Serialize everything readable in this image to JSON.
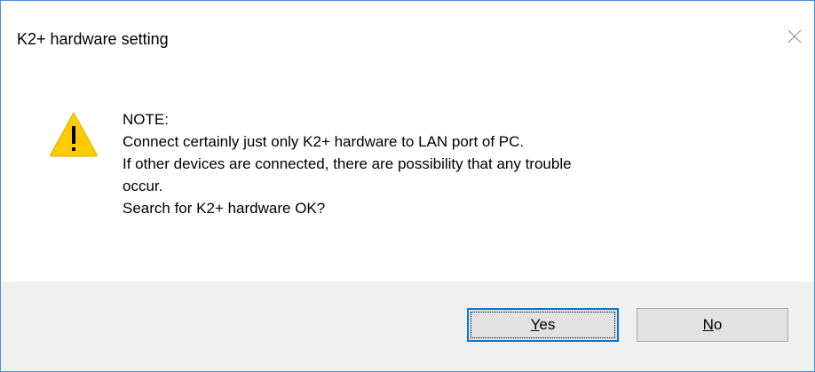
{
  "window": {
    "title": "K2+ hardware setting",
    "close_icon": "close-icon"
  },
  "message": {
    "icon": "warning-icon",
    "lines": [
      "NOTE:",
      "Connect certainly just only K2+ hardware to LAN port of PC.",
      "If other devices are connected, there are possibility that any trouble",
      "occur.",
      "Search for K2+ hardware OK?"
    ]
  },
  "buttons": {
    "yes": {
      "mnemonic": "Y",
      "rest": "es",
      "focused": true
    },
    "no": {
      "mnemonic": "N",
      "rest": "o"
    }
  },
  "colors": {
    "window_border": "#4a90d9",
    "footer_background": "#f0f0f0",
    "button_background": "#e1e1e1",
    "focus_border": "#0078d7",
    "warning_fill": "#ffcc00"
  }
}
